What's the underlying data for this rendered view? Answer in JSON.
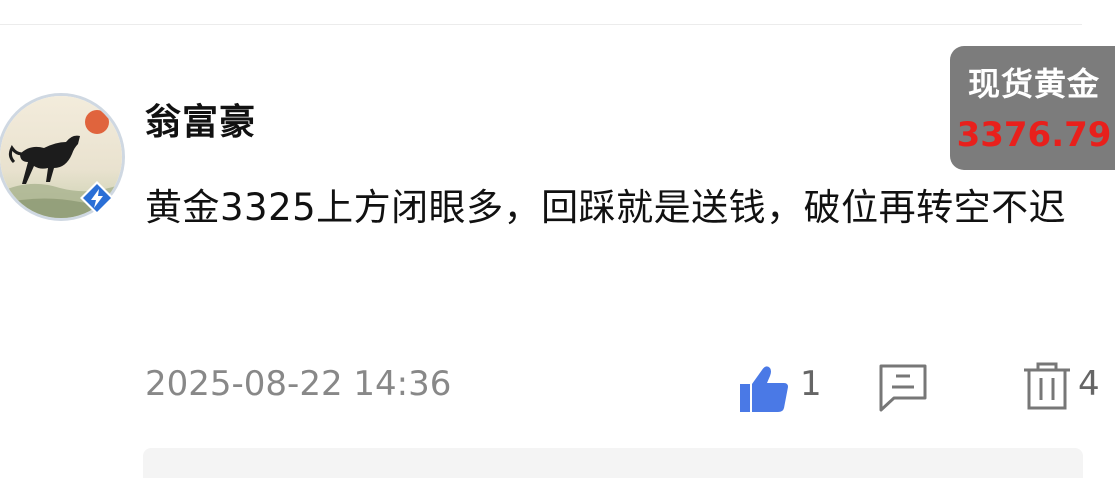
{
  "comment": {
    "username": "翁富豪",
    "text": "黄金3325上方闭眼多，回踩就是送钱，破位再转空不迟",
    "timestamp": "2025-08-22 14:36",
    "avatar_icon": "horse-painting-avatar",
    "badge_icon": "lightning-badge-icon"
  },
  "actions": {
    "like_count": "1",
    "comment_count": "4",
    "like_icon": "thumbs-up-icon",
    "comment_icon": "comment-icon",
    "delete_icon": "trash-icon",
    "like_color": "#4a79e6"
  },
  "price_widget": {
    "label": "现货黄金",
    "value": "3376.79",
    "value_color": "#e8201c"
  }
}
